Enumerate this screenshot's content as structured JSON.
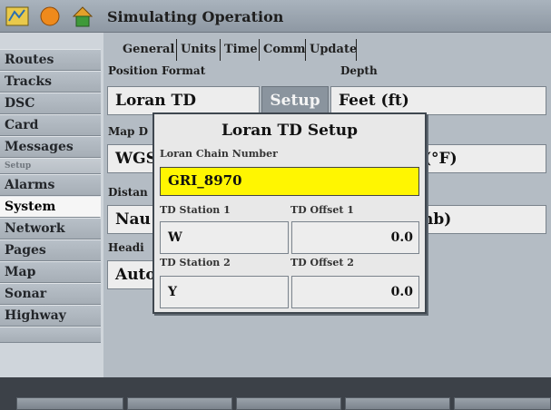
{
  "titlebar": {
    "title": "Simulating Operation"
  },
  "sidebar": {
    "items": [
      {
        "label": "Routes",
        "state": "normal"
      },
      {
        "label": "Tracks",
        "state": "normal"
      },
      {
        "label": "DSC",
        "state": "normal"
      },
      {
        "label": "Card",
        "state": "normal"
      },
      {
        "label": "Messages",
        "state": "normal"
      },
      {
        "label": "Setup",
        "state": "dim"
      },
      {
        "label": "Alarms",
        "state": "normal"
      },
      {
        "label": "System",
        "state": "selected"
      },
      {
        "label": "Network",
        "state": "normal"
      },
      {
        "label": "Pages",
        "state": "normal"
      },
      {
        "label": "Map",
        "state": "normal"
      },
      {
        "label": "Sonar",
        "state": "normal"
      },
      {
        "label": "Highway",
        "state": "normal"
      }
    ]
  },
  "tabs": [
    "General",
    "Units",
    "Time",
    "Comm",
    "Update"
  ],
  "main": {
    "position_format_label": "Position Format",
    "position_format_value": "Loran TD",
    "setup_button": "Setup",
    "depth_label": "Depth",
    "depth_value": "Feet (ft)",
    "map_datum_label": "Map D",
    "map_datum_value": "WGS",
    "temp_value": "(°F)",
    "distance_label": "Distan",
    "distance_value": "Nau",
    "pressure_value": "nb)",
    "heading_label": "Headi",
    "heading_value": "Auto"
  },
  "dialog": {
    "title": "Loran TD Setup",
    "chain_label": "Loran Chain Number",
    "chain_value": "GRI_8970",
    "station1_label": "TD Station 1",
    "station1_value": "W",
    "offset1_label": "TD Offset 1",
    "offset1_value": "0.0",
    "station2_label": "TD Station 2",
    "station2_value": "Y",
    "offset2_label": "TD Offset 2",
    "offset2_value": "0.0"
  },
  "colors": {
    "highlight": "#fff601",
    "title_bar": "#9aa4ae",
    "panel": "#b4bcc4"
  }
}
